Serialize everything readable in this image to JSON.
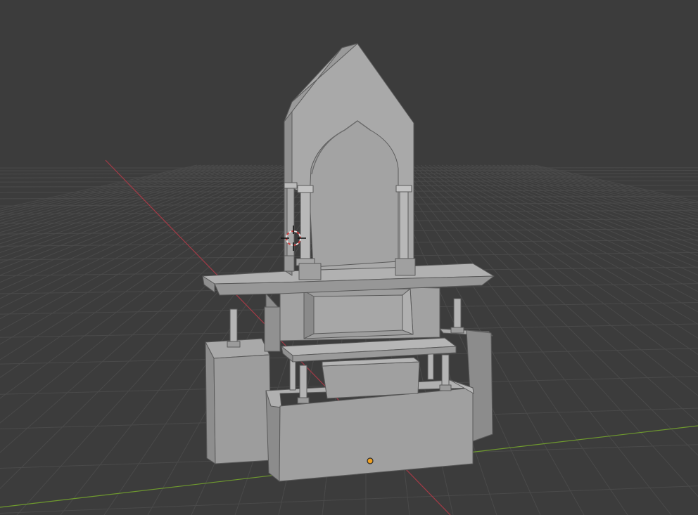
{
  "viewport": {
    "background": "#3c3c3c",
    "grid_color": "#4a4a4a",
    "axis_x_color": "#a33a46",
    "axis_y_color": "#6f9a2e"
  },
  "model": {
    "face_light": "#a8a8a8",
    "face_mid": "#9a9a9a",
    "face_dark": "#868686",
    "edge": "#5a5a5a"
  },
  "cursor": {
    "icon": "3d-cursor-icon",
    "ring_color_a": "#e0e0e0",
    "ring_color_b": "#d04040"
  },
  "origin_point": {
    "icon": "object-origin-icon",
    "color": "#f0a020"
  }
}
